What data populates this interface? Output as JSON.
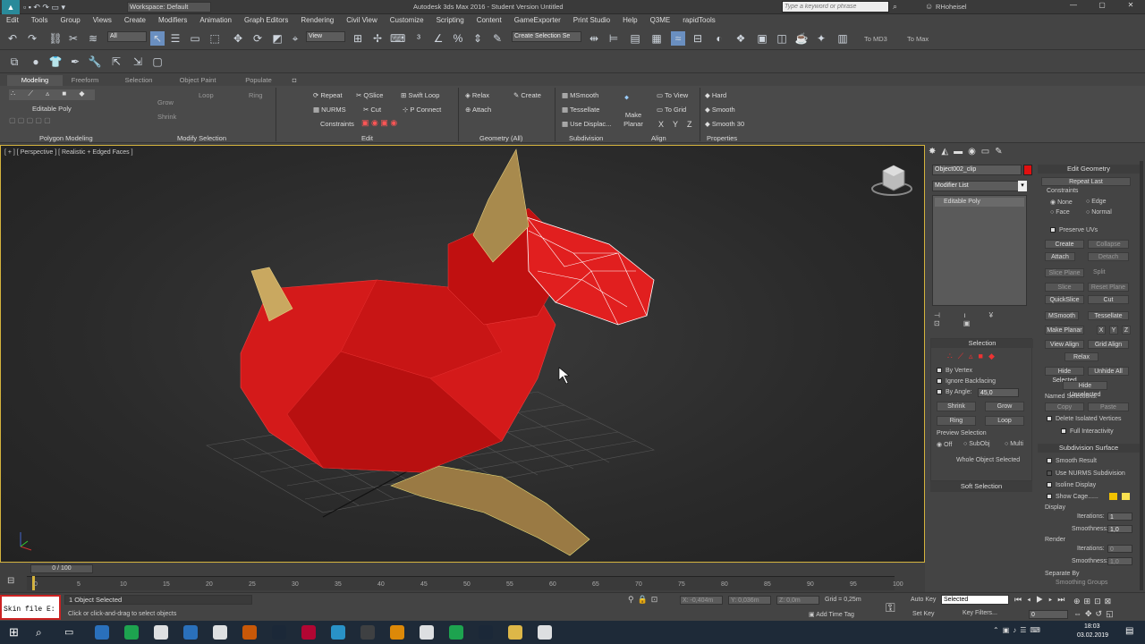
{
  "title": {
    "workspace": "Workspace: Default",
    "app_title": "Autodesk 3ds Max 2016 - Student Version   Untitled",
    "search_placeholder": "Type a keyword or phrase",
    "user": "RHoheisel"
  },
  "menus": [
    "Edit",
    "Tools",
    "Group",
    "Views",
    "Create",
    "Modifiers",
    "Animation",
    "Graph Editors",
    "Rendering",
    "Civil View",
    "Customize",
    "Scripting",
    "Content",
    "GameExporter",
    "Print Studio",
    "Help",
    "Q3ME",
    "rapidTools"
  ],
  "toolbar": {
    "selection_filter": "All",
    "ref_coord": "View",
    "named_selection": "Create Selection Se",
    "to_md3": "To MD3",
    "to_max": "To Max"
  },
  "ribbon": {
    "tabs": [
      "Modeling",
      "Freeform",
      "Selection",
      "Object Paint",
      "Populate"
    ],
    "editable_poly": "Editable Poly",
    "grow": "Grow",
    "shrink": "Shrink",
    "loop": "Loop",
    "ring": "Ring",
    "edit_items": [
      "Repeat",
      "QSlice",
      "Swift Loop",
      "NURMS",
      "Cut",
      "P Connect",
      "Constraints"
    ],
    "geometry_items": [
      "Relax",
      "Create",
      "Attach"
    ],
    "subdiv_items": [
      "MSmooth",
      "Tessellate",
      "Use Displac..."
    ],
    "make_planar": "Make Planar",
    "align_items": [
      "To View",
      "To Grid",
      "X",
      "Y",
      "Z"
    ],
    "props_items": [
      "Hard",
      "Smooth",
      "Smooth 30"
    ],
    "footers": [
      "Polygon Modeling",
      "Modify Selection",
      "Edit",
      "Geometry (All)",
      "Subdivision",
      "Align",
      "Properties"
    ]
  },
  "viewport": {
    "label": "[ + ] [ Perspective ] [ Realistic + Edged Faces ]"
  },
  "command_panel": {
    "object_name": "Object002_clip",
    "modifier_list": "Modifier List",
    "stack_item": "Editable Poly",
    "selection_title": "Selection",
    "by_vertex": "By Vertex",
    "ignore_backfacing": "Ignore Backfacing",
    "by_angle": "By Angle:",
    "angle_value": "45,0",
    "shrink": "Shrink",
    "grow": "Grow",
    "ring": "Ring",
    "loop": "Loop",
    "preview_selection": "Preview Selection",
    "off": "Off",
    "subobj": "SubObj",
    "multi": "Multi",
    "whole_object": "Whole Object Selected",
    "soft_selection": "Soft Selection"
  },
  "rollout": {
    "edit_geometry": "Edit Geometry",
    "repeat_last": "Repeat Last",
    "constraints": "Constraints",
    "none": "None",
    "edge": "Edge",
    "face": "Face",
    "normal": "Normal",
    "preserve_uvs": "Preserve UVs",
    "create": "Create",
    "collapse": "Collapse",
    "attach": "Attach",
    "detach": "Detach",
    "slice_plane": "Slice Plane",
    "split": "Split",
    "slice": "Slice",
    "reset_plane": "Reset Plane",
    "quickslice": "QuickSlice",
    "cut": "Cut",
    "msmooth": "MSmooth",
    "tessellate": "Tessellate",
    "make_planar": "Make Planar",
    "x": "X",
    "y": "Y",
    "z": "Z",
    "view_align": "View Align",
    "grid_align": "Grid Align",
    "relax": "Relax",
    "hide_selected": "Hide Selected",
    "unhide_all": "Unhide All",
    "hide_unselected": "Hide Unselected",
    "named_selections": "Named Selections:",
    "copy": "Copy",
    "paste": "Paste",
    "delete_isolated": "Delete Isolated Vertices",
    "full_interactivity": "Full Interactivity",
    "subdivision_surface": "Subdivision Surface",
    "smooth_result": "Smooth Result",
    "use_nurms": "Use NURMS Subdivision",
    "isoline_display": "Isoline Display",
    "show_cage": "Show Cage......",
    "display": "Display",
    "iterations": "Iterations:",
    "iter_value": "1",
    "smoothness": "Smoothness:",
    "smooth_value": "1,0",
    "render": "Render",
    "render_iter_value": "0",
    "render_smooth_value": "1,0",
    "separate_by": "Separate By",
    "smoothing_groups": "Smoothing Groups"
  },
  "timeline": {
    "frame": "0 / 100",
    "ticks": [
      "0",
      "5",
      "10",
      "15",
      "20",
      "25",
      "30",
      "35",
      "40",
      "45",
      "50",
      "55",
      "60",
      "65",
      "70",
      "75",
      "80",
      "85",
      "90",
      "95",
      "100"
    ]
  },
  "status": {
    "maxscript": "Skin file E:",
    "selected": "1 Object Selected",
    "prompt": "Click or click-and-drag to select objects",
    "x": "X: -0,404m",
    "y": "Y: 0,036m",
    "z": "Z: 0,0m",
    "grid": "Grid = 0,25m",
    "add_time_tag": "Add Time Tag",
    "auto_key": "Auto Key",
    "set_key": "Set Key",
    "key_mode": "Selected",
    "key_filters": "Key Filters...",
    "frame_field": "0"
  },
  "taskbar": {
    "time": "18:03",
    "date": "03.02.2019",
    "colors": [
      "#2d7dd2",
      "#1db954",
      "#ffffff",
      "#2d7dd2",
      "#ffffff",
      "#e66000",
      "#1b2838",
      "#c03",
      "#2ca5e0",
      "#444",
      "#ff9a00",
      "#ffffff",
      "#1db954",
      "#1b2838",
      "#ffd04b",
      "#ffffff"
    ]
  }
}
